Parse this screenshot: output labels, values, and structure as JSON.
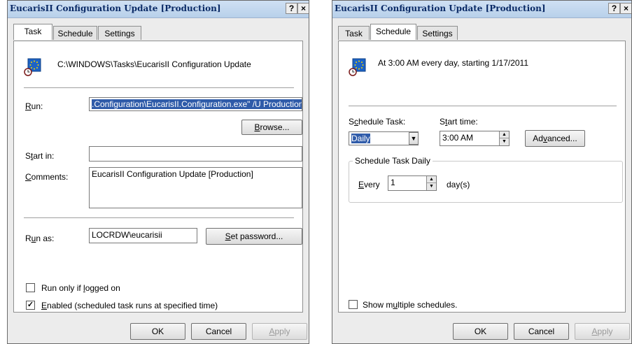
{
  "left_dialog": {
    "title": "EucarisII Configuration Update [Production]",
    "title_help": "?",
    "title_close": "×",
    "tabs": {
      "task": "Task",
      "schedule": "Schedule",
      "settings": "Settings"
    },
    "task_path": "C:\\WINDOWS\\Tasks\\EucarisII Configuration Update",
    "run_label": "Run:",
    "run_value": ".Configuration\\EucarisII.Configuration.exe\" /U Production",
    "browse_label": "Browse...",
    "start_in_label": "Start in:",
    "start_in_value": "",
    "comments_label": "Comments:",
    "comments_value": "EucarisII Configuration Update [Production]",
    "run_as_label": "Run as:",
    "run_as_value": "LOCRDW\\eucarisii",
    "set_password_label": "Set password...",
    "run_only_logged_on_label": "Run only if logged on",
    "run_only_logged_on_checked": false,
    "enabled_label": "Enabled (scheduled task runs at specified time)",
    "enabled_checked": true,
    "ok_label": "OK",
    "cancel_label": "Cancel",
    "apply_label": "Apply"
  },
  "right_dialog": {
    "title": "EucarisII Configuration Update [Production]",
    "title_help": "?",
    "title_close": "×",
    "tabs": {
      "task": "Task",
      "schedule": "Schedule",
      "settings": "Settings"
    },
    "schedule_summary": "At 3:00 AM every day, starting 1/17/2011",
    "schedule_task_label": "Schedule Task:",
    "schedule_task_value": "Daily",
    "start_time_label": "Start time:",
    "start_time_value": "3:00 AM",
    "advanced_label": "Advanced...",
    "group_title": "Schedule Task Daily",
    "every_label": "Every",
    "every_value": "1",
    "days_label": "day(s)",
    "show_multiple_label": "Show multiple schedules.",
    "show_multiple_checked": false,
    "ok_label": "OK",
    "cancel_label": "Cancel",
    "apply_label": "Apply"
  },
  "icons": {
    "task": "scheduled-task-icon",
    "dropdown": "dropdown-arrow-icon",
    "spin": "spin-up-down-icon"
  },
  "colors": {
    "title_text": "#0a2a66",
    "selection": "#2f5ba9",
    "dialog_bg": "#ececec"
  }
}
